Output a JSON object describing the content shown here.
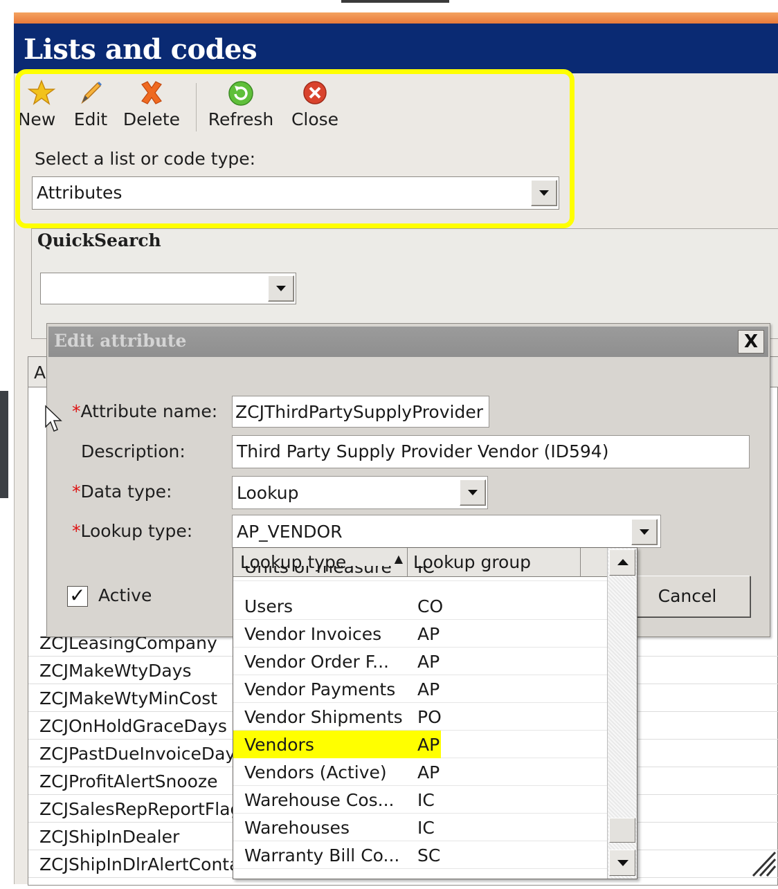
{
  "window": {
    "title": "Lists and codes"
  },
  "toolbar": {
    "new_label": "New",
    "edit_label": "Edit",
    "delete_label": "Delete",
    "refresh_label": "Refresh",
    "close_label": "Close",
    "icons": {
      "new": "star-icon",
      "edit": "pencil-icon",
      "delete": "x-icon",
      "refresh": "refresh-icon",
      "close": "close-circle-icon"
    }
  },
  "selector": {
    "label": "Select a list or code type:",
    "value": "Attributes"
  },
  "quicksearch": {
    "label": "QuickSearch",
    "value": ""
  },
  "grid": {
    "header_fragment": "A",
    "rows": [
      "ZCJLeasingCompany",
      "ZCJMakeWtyDays",
      "ZCJMakeWtyMinCost",
      "ZCJOnHoldGraceDays",
      "ZCJPastDueInvoiceDays",
      "ZCJProfitAlertSnooze",
      "ZCJSalesRepReportFlag",
      "ZCJShipInDealer",
      "ZCJShipInDlrAlertContact"
    ]
  },
  "dialog": {
    "title": "Edit attribute",
    "close_glyph": "X",
    "attribute_name": {
      "label": "Attribute name:",
      "value": "ZCJThirdPartySupplyProvider"
    },
    "description": {
      "label": "Description:",
      "value": "Third Party Supply Provider Vendor (ID594)"
    },
    "data_type": {
      "label": "Data type:",
      "value": "Lookup"
    },
    "lookup_type": {
      "label": "Lookup type:",
      "value": "AP_VENDOR"
    },
    "required_mark": "*",
    "active": {
      "label": "Active",
      "checked": true,
      "glyph": "✓"
    },
    "cancel_label": "Cancel"
  },
  "lookup_dropdown": {
    "columns": [
      "Lookup type",
      "Lookup group"
    ],
    "sort_indicator": "▲",
    "rows": [
      {
        "type": "Units of measure",
        "group": "IC"
      },
      {
        "type": "Users",
        "group": "CO"
      },
      {
        "type": "Vendor Invoices",
        "group": "AP"
      },
      {
        "type": "Vendor Order F...",
        "group": "AP"
      },
      {
        "type": "Vendor Payments",
        "group": "AP"
      },
      {
        "type": "Vendor Shipments",
        "group": "PO"
      },
      {
        "type": "Vendors",
        "group": "AP",
        "selected": true
      },
      {
        "type": "Vendors (Active)",
        "group": "AP"
      },
      {
        "type": "Warehouse Cos...",
        "group": "IC"
      },
      {
        "type": "Warehouses",
        "group": "IC"
      },
      {
        "type": "Warranty Bill Co...",
        "group": "SC"
      }
    ],
    "highlight_color": "#ffff00"
  },
  "colors": {
    "title_bar": "#0a2a73",
    "accent_orange": "#e97a3a",
    "callout_yellow": "#ffff00",
    "required_red": "#dd1111"
  }
}
